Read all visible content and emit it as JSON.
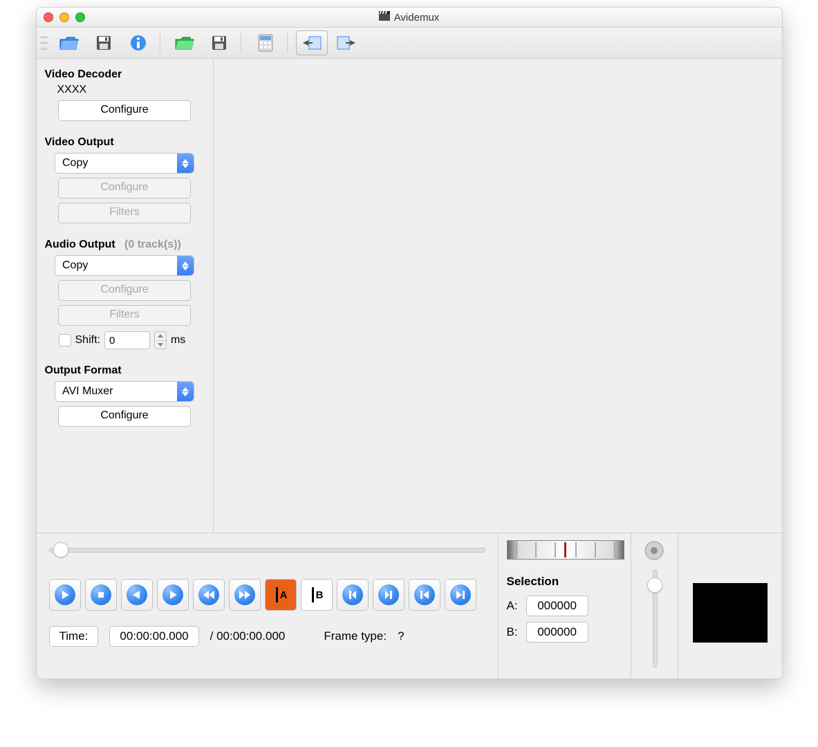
{
  "window": {
    "title": "Avidemux"
  },
  "sidebar": {
    "video_decoder": {
      "title": "Video Decoder",
      "value": "XXXX",
      "configure": "Configure"
    },
    "video_output": {
      "title": "Video Output",
      "select": "Copy",
      "configure": "Configure",
      "filters": "Filters"
    },
    "audio_output": {
      "title": "Audio Output",
      "tracks_label": "(0 track(s))",
      "select": "Copy",
      "configure": "Configure",
      "filters": "Filters",
      "shift_label": "Shift:",
      "shift_value": "0",
      "shift_unit": "ms"
    },
    "output_format": {
      "title": "Output Format",
      "select": "AVI Muxer",
      "configure": "Configure"
    }
  },
  "bottom": {
    "time_label": "Time:",
    "time_value": "00:00:00.000",
    "time_total": "/ 00:00:00.000",
    "frame_type_label": "Frame type:",
    "frame_type_value": "?",
    "selection_title": "Selection",
    "a_label": "A:",
    "a_value": "000000",
    "b_label": "B:",
    "b_value": "000000",
    "mark_a": "A",
    "mark_b": "B"
  }
}
